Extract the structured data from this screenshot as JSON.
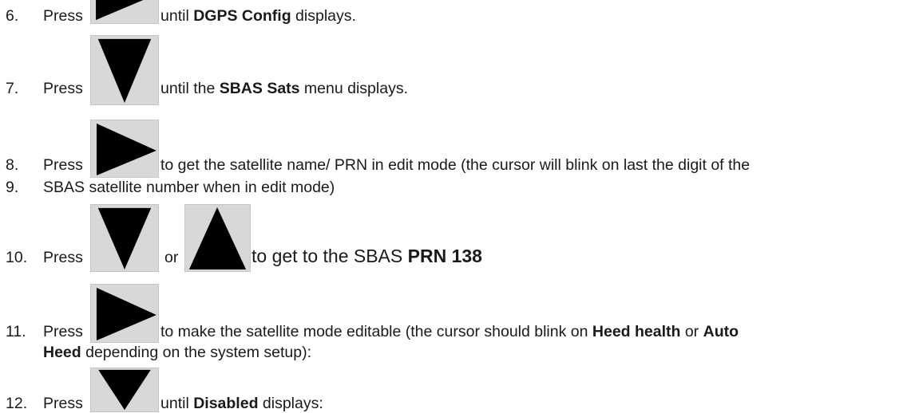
{
  "steps": [
    {
      "num": "6.",
      "press": "Press",
      "text_before": "until ",
      "bold": "DGPS Config",
      "text_after": " displays.",
      "icon": "right-arrow-icon"
    },
    {
      "num": "7.",
      "press": "Press",
      "text_before": "until the ",
      "bold": "SBAS Sats",
      "text_after": " menu displays.",
      "icon": "down-arrow-icon"
    },
    {
      "num": "8.",
      "press": "Press",
      "text": "to get the satellite name/ PRN in edit mode (the cursor will blink on last the digit of the",
      "icon": "right-arrow-icon"
    },
    {
      "num": "9.",
      "text": "SBAS satellite number when in edit mode)"
    },
    {
      "num": "10.",
      "press": "Press",
      "or": "or",
      "text_before": "to get to the SBAS ",
      "bold": "PRN 138",
      "icon": "down-arrow-icon",
      "icon2": "up-arrow-icon"
    },
    {
      "num": "11.",
      "press": "Press",
      "text_before": "to make the satellite mode editable (the cursor should blink on ",
      "bold": "Heed health",
      "text_mid": " or ",
      "bold2": "Auto",
      "icon": "right-arrow-icon"
    },
    {
      "continuation_bold": "Heed",
      "continuation_text": " depending on the system setup):"
    },
    {
      "num": "12.",
      "press": "Press",
      "text_before": "until ",
      "bold": "Disabled",
      "text_after": " displays:",
      "icon": "down-arrow-icon"
    }
  ]
}
